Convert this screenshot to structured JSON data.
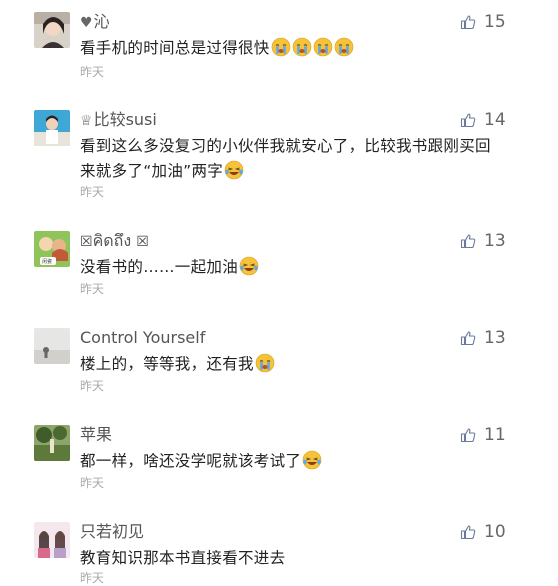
{
  "comments": [
    {
      "prefix_icon": "heart-icon",
      "username": "沁",
      "text": "看手机的时间总是过得很快",
      "emojis": [
        "crying-face",
        "crying-face",
        "crying-face",
        "crying-face"
      ],
      "time": "昨天",
      "likes": "15"
    },
    {
      "prefix_icon": "crown-icon",
      "username": "比较susi",
      "text_line1": "看到这么多没复习的小伙伴我就安心了，比较我书跟刚买回",
      "text_line2": "来就多了“加油”两字",
      "emojis": [
        "laugh-cry-face"
      ],
      "time": "昨天",
      "likes": "14"
    },
    {
      "box_left": "☒",
      "username": "คิดถึง",
      "box_right": "☒",
      "text": "没看书的……一起加油",
      "emojis": [
        "laugh-cry-face"
      ],
      "time": "昨天",
      "likes": "13"
    },
    {
      "username": "Control Yourself",
      "text": "楼上的，等等我，还有我",
      "emojis": [
        "crying-face"
      ],
      "time": "昨天",
      "likes": "13"
    },
    {
      "username": "苹果",
      "text": "都一样，啥还没学呢就该考试了",
      "emojis": [
        "laugh-cry-face"
      ],
      "time": "昨天",
      "likes": "11"
    },
    {
      "username": "只若初见",
      "text": "教育知识那本书直接看不进去",
      "time": "昨天",
      "likes": "10"
    }
  ],
  "colors": {
    "like_icon": "#6a7a9a",
    "emoji_yellow": "#f5c33b",
    "tears": "#5aa9e6"
  }
}
